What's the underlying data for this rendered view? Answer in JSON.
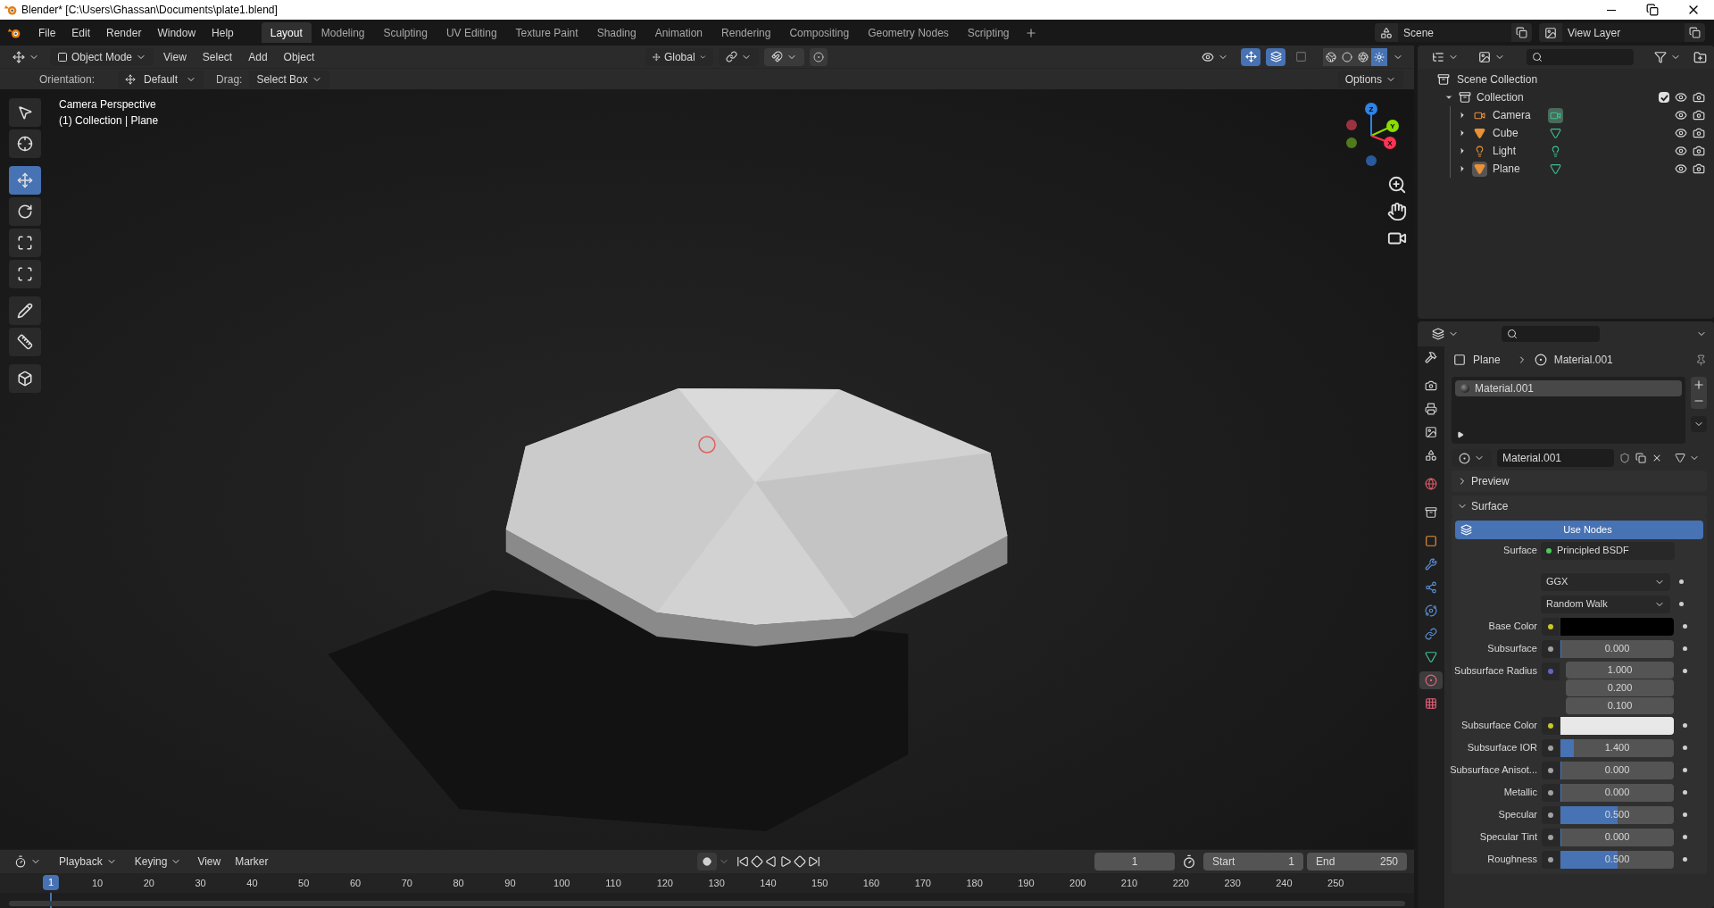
{
  "window": {
    "title": "Blender* [C:\\Users\\Ghassan\\Documents\\plate1.blend]"
  },
  "menu": [
    "File",
    "Edit",
    "Render",
    "Window",
    "Help"
  ],
  "workspaces": [
    {
      "label": "Layout",
      "selected": true
    },
    {
      "label": "Modeling",
      "selected": false
    },
    {
      "label": "Sculpting",
      "selected": false
    },
    {
      "label": "UV Editing",
      "selected": false
    },
    {
      "label": "Texture Paint",
      "selected": false
    },
    {
      "label": "Shading",
      "selected": false
    },
    {
      "label": "Animation",
      "selected": false
    },
    {
      "label": "Rendering",
      "selected": false
    },
    {
      "label": "Compositing",
      "selected": false
    },
    {
      "label": "Geometry Nodes",
      "selected": false
    },
    {
      "label": "Scripting",
      "selected": false
    }
  ],
  "scene": "Scene",
  "view_layer": "View Layer",
  "viewport_header": {
    "mode": "Object Mode",
    "menus": [
      "View",
      "Select",
      "Add",
      "Object"
    ],
    "orientation": "Global",
    "toggles": [
      {
        "kind": "gizmo",
        "on": true
      },
      {
        "kind": "overlay",
        "on": true
      },
      {
        "kind": "xray",
        "on": false
      }
    ],
    "shading": [
      {
        "kind": "wireframe",
        "selected": false
      },
      {
        "kind": "solid",
        "selected": false
      },
      {
        "kind": "material",
        "selected": false
      },
      {
        "kind": "rendered",
        "selected": true
      }
    ]
  },
  "tool_settings": {
    "orientation_label": "Orientation:",
    "orientation": "Default",
    "drag_label": "Drag:",
    "drag": "Select Box",
    "options": "Options"
  },
  "tools": [
    {
      "kind": "select",
      "selected": false
    },
    {
      "kind": "cursor",
      "selected": false
    },
    {
      "kind": "move",
      "selected": true
    },
    {
      "kind": "rotate",
      "selected": false
    },
    {
      "kind": "scale",
      "selected": false
    },
    {
      "kind": "transform",
      "selected": false
    },
    {
      "kind": "annotate",
      "selected": false
    },
    {
      "kind": "measure",
      "selected": false
    },
    {
      "kind": "add_cube",
      "selected": false
    }
  ],
  "viewport": {
    "info": [
      "Camera Perspective",
      "(1) Collection | Plane"
    ],
    "axes": [
      "Z",
      "Y",
      "X"
    ]
  },
  "outliner": {
    "root": "Scene Collection",
    "collections": [
      {
        "label": "Collection",
        "expanded": true,
        "checked": true,
        "children": [
          {
            "label": "Camera",
            "kind": "camera",
            "expanded": false,
            "highlighted": false,
            "data_highlighted": true
          },
          {
            "label": "Cube",
            "kind": "mesh",
            "expanded": false,
            "highlighted": false,
            "data_highlighted": false
          },
          {
            "label": "Light",
            "kind": "light",
            "expanded": false,
            "highlighted": false,
            "data_highlighted": false
          },
          {
            "label": "Plane",
            "kind": "mesh",
            "expanded": false,
            "highlighted": true,
            "data_highlighted": false
          }
        ]
      }
    ]
  },
  "properties": {
    "tabs": [
      {
        "kind": "tool",
        "selected": false
      },
      {
        "kind": "render",
        "selected": false
      },
      {
        "kind": "output",
        "selected": false
      },
      {
        "kind": "view_layer",
        "selected": false
      },
      {
        "kind": "scene",
        "selected": false
      },
      {
        "kind": "world",
        "selected": false
      },
      {
        "kind": "collection",
        "selected": false
      },
      {
        "kind": "object",
        "selected": false
      },
      {
        "kind": "modifiers",
        "selected": false
      },
      {
        "kind": "particles",
        "selected": false
      },
      {
        "kind": "physics",
        "selected": false
      },
      {
        "kind": "constraints",
        "selected": false
      },
      {
        "kind": "data",
        "selected": false
      },
      {
        "kind": "material",
        "selected": true
      },
      {
        "kind": "texture",
        "selected": false
      }
    ],
    "breadcrumb": [
      "Plane",
      "Material.001"
    ],
    "slots": [
      {
        "name": "Material.001",
        "selected": true
      }
    ],
    "material": "Material.001",
    "panels": [
      {
        "label": "Preview",
        "expanded": false
      },
      {
        "label": "Surface",
        "expanded": true
      }
    ],
    "use_nodes": "Use Nodes",
    "rows": [
      {
        "kind": "link",
        "label": "Surface",
        "color": "#4cc95a",
        "value": "Principled BSDF"
      },
      {
        "kind": "dropdown",
        "value": "GGX"
      },
      {
        "kind": "dropdown",
        "value": "Random Walk"
      },
      {
        "kind": "color",
        "label": "Base Color",
        "color": "#c7c729",
        "swatch": {
          "color": "#000000"
        }
      },
      {
        "kind": "slider",
        "label": "Subsurface",
        "color": "#a1a1a1",
        "value": "0.000",
        "level": 0
      },
      {
        "kind": "vector",
        "label": "Subsurface Radius",
        "color": "#6363c7",
        "values": [
          "1.000",
          "0.200",
          "0.100"
        ]
      },
      {
        "kind": "color",
        "label": "Subsurface Color",
        "color": "#c7c729",
        "swatch": {
          "color": "#e8e8e8"
        }
      },
      {
        "kind": "slider",
        "label": "Subsurface IOR",
        "color": "#a1a1a1",
        "value": "1.400",
        "level": 0.12
      },
      {
        "kind": "slider",
        "label": "Subsurface Anisot...",
        "color": "#a1a1a1",
        "value": "0.000",
        "level": 0
      },
      {
        "kind": "slider",
        "label": "Metallic",
        "color": "#a1a1a1",
        "value": "0.000",
        "level": 0
      },
      {
        "kind": "slider",
        "label": "Specular",
        "color": "#a1a1a1",
        "value": "0.500",
        "level": 0.5
      },
      {
        "kind": "slider",
        "label": "Specular Tint",
        "color": "#a1a1a1",
        "value": "0.000",
        "level": 0
      },
      {
        "kind": "slider",
        "label": "Roughness",
        "color": "#a1a1a1",
        "value": "0.500",
        "level": 0.5
      }
    ]
  },
  "timeline": {
    "menus": [
      "Playback",
      "Keying",
      "View",
      "Marker"
    ],
    "current_frame": "1",
    "start_label": "Start",
    "start": "1",
    "end_label": "End",
    "end": "250",
    "ruler": {
      "current": "1",
      "ticks": [
        "10",
        "20",
        "30",
        "40",
        "50",
        "60",
        "70",
        "80",
        "90",
        "100",
        "110",
        "120",
        "130",
        "140",
        "150",
        "160",
        "170",
        "180",
        "190",
        "200",
        "210",
        "220",
        "230",
        "240",
        "250"
      ]
    }
  }
}
